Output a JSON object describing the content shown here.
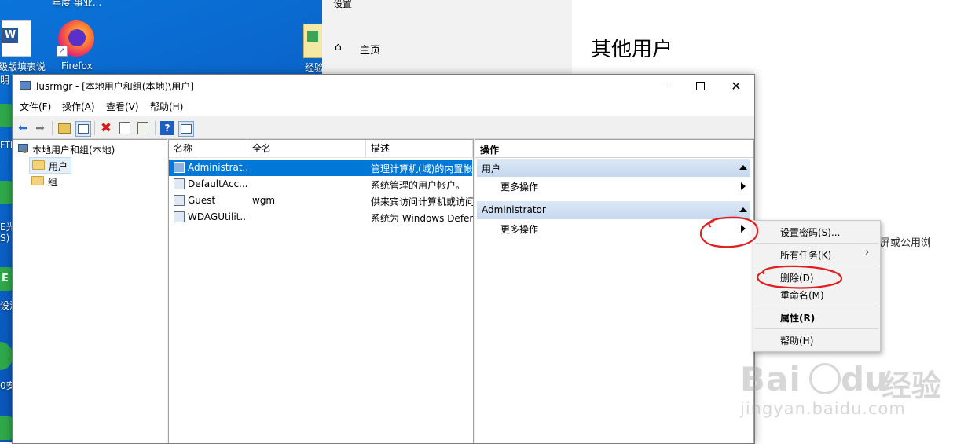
{
  "desktop": {
    "top_fragment": "年度 事业...",
    "icons": [
      {
        "label": "级版填表说",
        "sub": "明"
      },
      {
        "label": "Firefox"
      },
      {
        "label": "经验"
      }
    ],
    "left_fragments": [
      "FTP",
      "E光",
      "S)",
      "E",
      "设沃",
      "0安"
    ]
  },
  "settings": {
    "title": "设置",
    "home_label": "主页",
    "page_title": "其他用户",
    "fragment": "屏或公用浏"
  },
  "window": {
    "title": "lusrmgr - [本地用户和组(本地)\\用户]",
    "menu": [
      "文件(F)",
      "操作(A)",
      "查看(V)",
      "帮助(H)"
    ],
    "tree": {
      "root": "本地用户和组(本地)",
      "children": [
        "用户",
        "组"
      ]
    },
    "columns": [
      "名称",
      "全名",
      "描述"
    ],
    "users": [
      {
        "name": "Administrat...",
        "fullname": "",
        "desc": "管理计算机(域)的内置帐户"
      },
      {
        "name": "DefaultAcc...",
        "fullname": "",
        "desc": "系统管理的用户帐户。"
      },
      {
        "name": "Guest",
        "fullname": "wgm",
        "desc": "供来宾访问计算机或访问域"
      },
      {
        "name": "WDAGUtilit...",
        "fullname": "",
        "desc": "系统为 Windows Defender"
      }
    ],
    "actions": {
      "title": "操作",
      "sections": [
        {
          "header": "用户",
          "item": "更多操作"
        },
        {
          "header": "Administrator",
          "item": "更多操作"
        }
      ]
    }
  },
  "context_menu": {
    "items": [
      "设置密码(S)...",
      "所有任务(K)",
      "删除(D)",
      "重命名(M)",
      "属性(R)",
      "帮助(H)"
    ]
  },
  "watermark": {
    "logo": "Bai",
    "logo2": "du",
    "brand_cn": "经验",
    "url": "jingyan.baidu.com"
  },
  "colors": {
    "selection": "#0078d7",
    "annotation": "#e02020"
  }
}
